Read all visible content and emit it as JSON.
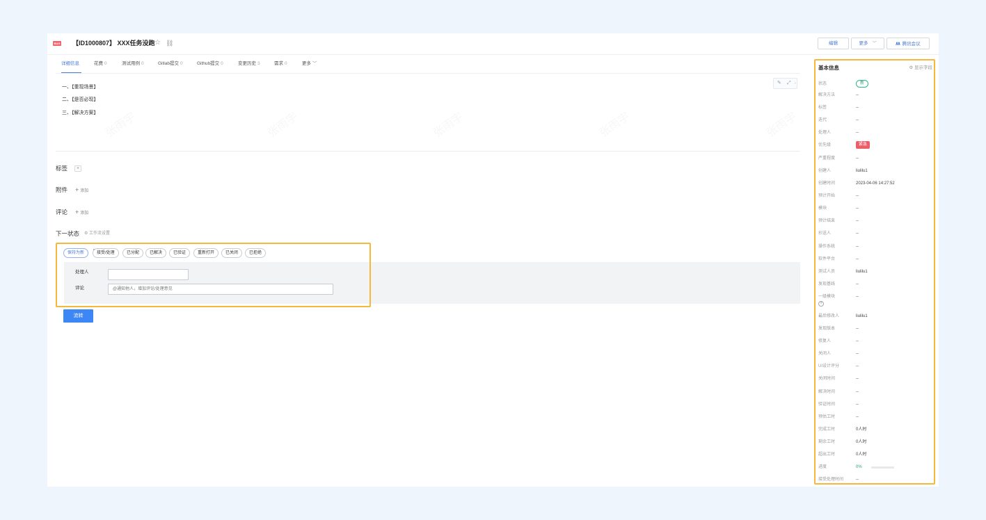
{
  "header": {
    "badge": "BUG",
    "title": "【ID1000807】 XXX任务没跑",
    "edit_label": "编辑",
    "more_label": "更多",
    "meeting_label": "腾讯会议"
  },
  "tabs": [
    {
      "label": "详细信息",
      "count": ""
    },
    {
      "label": "花费",
      "count": "0"
    },
    {
      "label": "测试用例",
      "count": "0"
    },
    {
      "label": "Gitlab提交",
      "count": "0"
    },
    {
      "label": "Github提交",
      "count": "0"
    },
    {
      "label": "变更历史",
      "count": "3"
    },
    {
      "label": "需求",
      "count": "0"
    },
    {
      "label": "更多",
      "count": ""
    }
  ],
  "description": [
    "一、【重现场景】",
    "二、【是否必现】",
    "三、【解决方案】"
  ],
  "watermark": "张雨宇",
  "sections": {
    "tags_title": "标签",
    "attachments_title": "附件",
    "attachments_add": "添加",
    "comments_title": "评论",
    "comments_add": "添加",
    "next_state_title": "下一状态",
    "workflow_link": "工作流设置"
  },
  "next_states": [
    "保持为新",
    "接受/处理",
    "已分配",
    "已解决",
    "已验证",
    "重新打开",
    "已关闭",
    "已拒绝"
  ],
  "form": {
    "assignee_label": "处理人",
    "assignee_value": "",
    "comment_label": "评论",
    "comment_placeholder": "@通知他人，增加评论/处理意见"
  },
  "submit_label": "流转",
  "sidebar": {
    "title": "基本信息",
    "show_fields": "显示字段",
    "fields": [
      {
        "key": "状态",
        "value": "新",
        "type": "status"
      },
      {
        "key": "解决方法",
        "value": "--"
      },
      {
        "key": "标签",
        "value": "--"
      },
      {
        "key": "迭代",
        "value": "--"
      },
      {
        "key": "处理人",
        "value": "--"
      },
      {
        "key": "优先级",
        "value": "紧急",
        "type": "priority"
      },
      {
        "key": "严重程度",
        "value": "--"
      },
      {
        "key": "创建人",
        "value": "liulilu1"
      },
      {
        "key": "创建时间",
        "value": "2023-04-06 14:27:52"
      },
      {
        "key": "预计开始",
        "value": "--"
      },
      {
        "key": "模块",
        "value": "--"
      },
      {
        "key": "预计结束",
        "value": "--"
      },
      {
        "key": "抄送人",
        "value": "--"
      },
      {
        "key": "操作系统",
        "value": "--"
      },
      {
        "key": "软件平台",
        "value": "--"
      },
      {
        "key": "测试人员",
        "value": "liulilu1"
      },
      {
        "key": "发现基线",
        "value": "--"
      },
      {
        "key": "一级模块",
        "value": "--",
        "type": "help"
      },
      {
        "key": "最后修改人",
        "value": "liulilu1"
      },
      {
        "key": "发现版本",
        "value": "--"
      },
      {
        "key": "修复人",
        "value": "--"
      },
      {
        "key": "关闭人",
        "value": "--"
      },
      {
        "key": "UI设计评分",
        "value": "--"
      },
      {
        "key": "关闭时间",
        "value": "--"
      },
      {
        "key": "解决时间",
        "value": "--"
      },
      {
        "key": "验证时间",
        "value": "--"
      },
      {
        "key": "预估工时",
        "value": "--"
      },
      {
        "key": "完成工时",
        "value": "0人时"
      },
      {
        "key": "剩余工时",
        "value": "0人时"
      },
      {
        "key": "超出工时",
        "value": "0人时"
      },
      {
        "key": "进度",
        "value": "0%",
        "type": "progress",
        "progress": 0
      },
      {
        "key": "接受处理时间",
        "value": "--"
      }
    ]
  }
}
